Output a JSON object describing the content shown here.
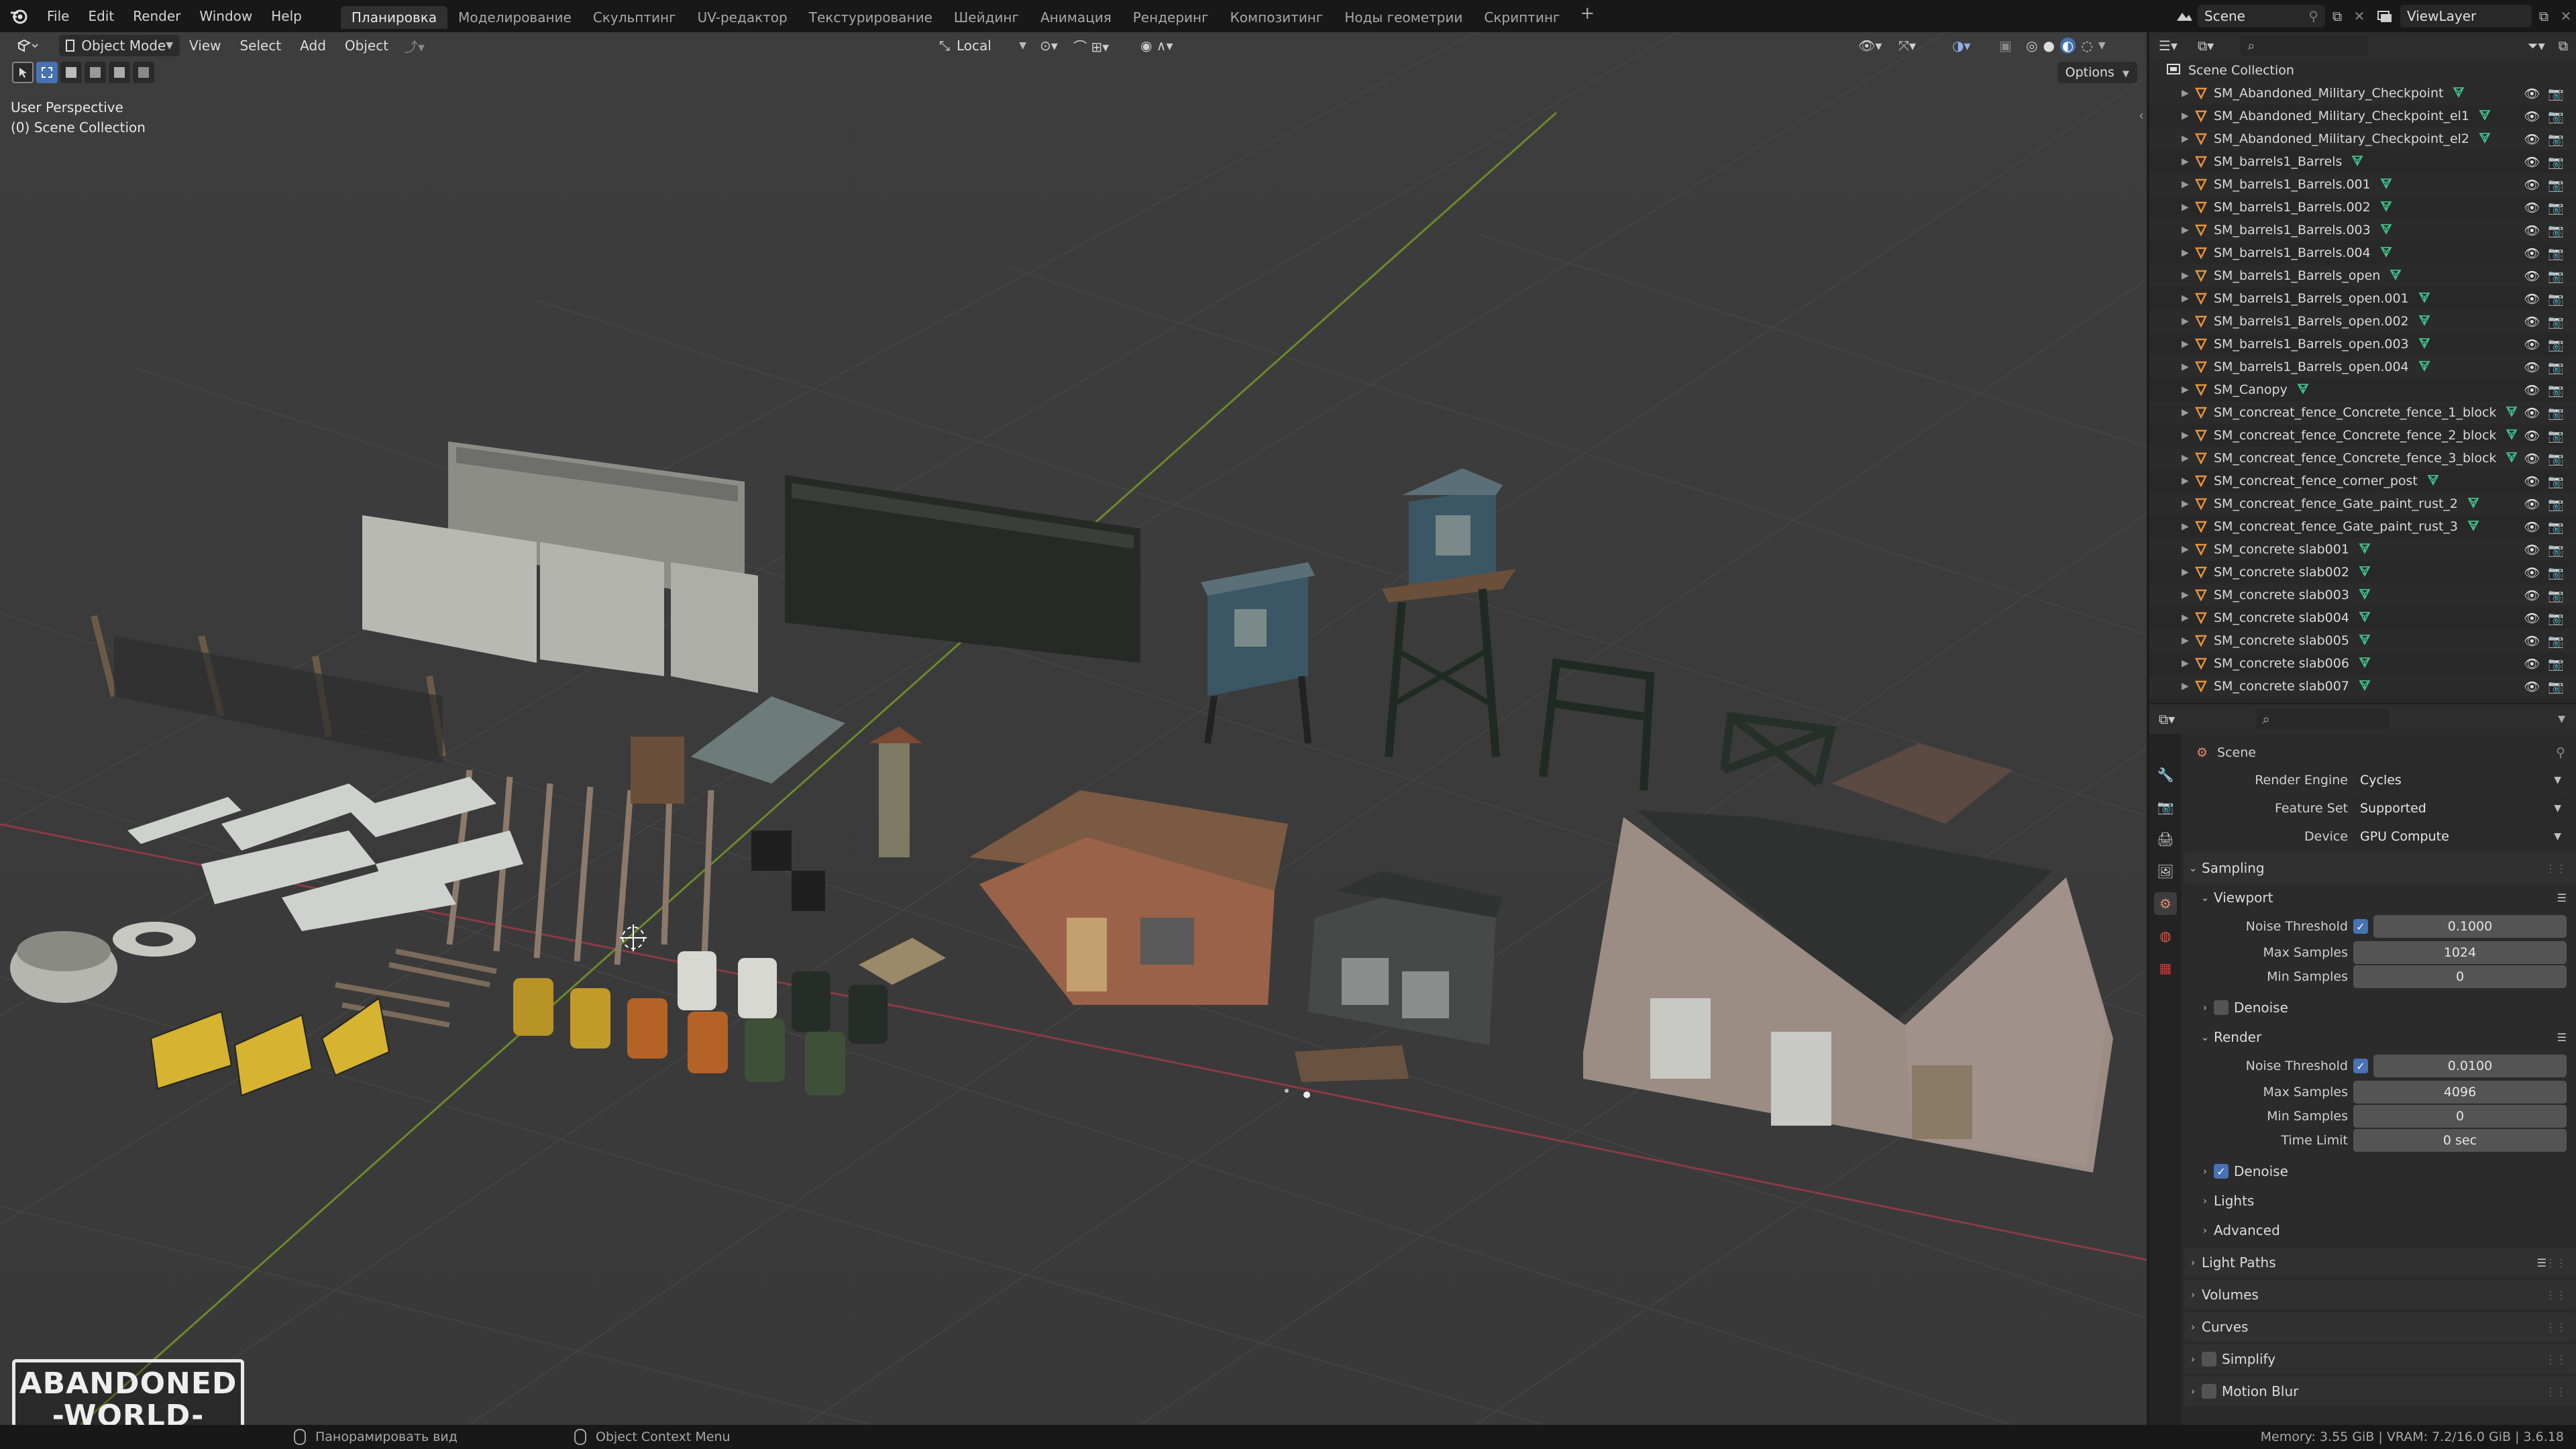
{
  "topbar": {
    "menus": [
      "File",
      "Edit",
      "Render",
      "Window",
      "Help"
    ],
    "workspaces": [
      "Планировка",
      "Моделирование",
      "Скульптинг",
      "UV-редактор",
      "Текстурирование",
      "Шейдинг",
      "Анимация",
      "Рендеринг",
      "Композитинг",
      "Ноды геометрии",
      "Скриптинг"
    ],
    "active_workspace": "Планировка",
    "add_workspace": "+",
    "scene_name": "Scene",
    "view_layer": "ViewLayer"
  },
  "viewport": {
    "mode": "Object Mode",
    "menus": [
      "View",
      "Select",
      "Add",
      "Object"
    ],
    "transform_orientation": "Local",
    "options_label": "Options",
    "overlay_line1": "User Perspective",
    "overlay_line2": "(0) Scene Collection",
    "logo_line1": "ABANDONED",
    "logo_line2": "-WORLD-"
  },
  "outliner": {
    "root": "Scene Collection",
    "items": [
      "SM_Abandoned_Military_Checkpoint",
      "SM_Abandoned_Military_Checkpoint_el1",
      "SM_Abandoned_Military_Checkpoint_el2",
      "SM_barrels1_Barrels",
      "SM_barrels1_Barrels.001",
      "SM_barrels1_Barrels.002",
      "SM_barrels1_Barrels.003",
      "SM_barrels1_Barrels.004",
      "SM_barrels1_Barrels_open",
      "SM_barrels1_Barrels_open.001",
      "SM_barrels1_Barrels_open.002",
      "SM_barrels1_Barrels_open.003",
      "SM_barrels1_Barrels_open.004",
      "SM_Canopy",
      "SM_concreat_fence_Concrete_fence_1_block",
      "SM_concreat_fence_Concrete_fence_2_block",
      "SM_concreat_fence_Concrete_fence_3_block",
      "SM_concreat_fence_corner_post",
      "SM_concreat_fence_Gate_paint_rust_2",
      "SM_concreat_fence_Gate_paint_rust_3",
      "SM_concrete slab001",
      "SM_concrete slab002",
      "SM_concrete slab003",
      "SM_concrete slab004",
      "SM_concrete slab005",
      "SM_concrete slab006",
      "SM_concrete slab007"
    ]
  },
  "properties": {
    "context": "Scene",
    "render_engine_label": "Render Engine",
    "render_engine": "Cycles",
    "feature_set_label": "Feature Set",
    "feature_set": "Supported",
    "device_label": "Device",
    "device": "GPU Compute",
    "sampling": "Sampling",
    "viewport_sub": "Viewport",
    "noise_threshold_label": "Noise Threshold",
    "vp_noise_threshold": "0.1000",
    "max_samples_label": "Max Samples",
    "vp_max_samples": "1024",
    "min_samples_label": "Min Samples",
    "vp_min_samples": "0",
    "denoise_label": "Denoise",
    "render_sub": "Render",
    "r_noise_threshold": "0.0100",
    "r_max_samples": "4096",
    "r_min_samples": "0",
    "time_limit_label": "Time Limit",
    "r_time_limit": "0 sec",
    "lights": "Lights",
    "advanced": "Advanced",
    "light_paths": "Light Paths",
    "volumes": "Volumes",
    "curves": "Curves",
    "simplify": "Simplify",
    "motion_blur": "Motion Blur"
  },
  "statusbar": {
    "pan_hint": "Панорамировать вид",
    "context_hint": "Object Context Menu",
    "stats": "Memory: 3.55 GiB | VRAM: 7.2/16.0 GiB | 3.6.18"
  },
  "colors": {
    "accent": "#4772b3",
    "mesh_orange": "#e8923a",
    "mesh_green": "#3fbf8a",
    "x_axis": "#8a3a44",
    "y_axis": "#6b8a2a"
  }
}
